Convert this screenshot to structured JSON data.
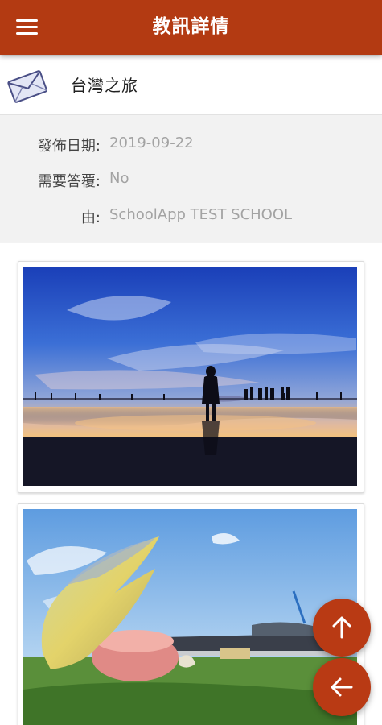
{
  "header": {
    "title": "教訊詳情",
    "menu_icon": "hamburger-menu-icon",
    "color": "#b33a12"
  },
  "message": {
    "icon": "envelope-icon",
    "subject": "台灣之旅"
  },
  "details": [
    {
      "label": "發佈日期:",
      "value": "2019-09-22"
    },
    {
      "label": "需要答覆:",
      "value": "No"
    },
    {
      "label": "由:",
      "value": "SchoolApp TEST SCHOOL"
    }
  ],
  "attachments": [
    {
      "type": "photo",
      "scene": "silhouette-sunset-beach"
    },
    {
      "type": "photo",
      "scene": "crab-claw-sculpture"
    }
  ],
  "actions": {
    "scroll_top_icon": "arrow-up-icon",
    "back_icon": "arrow-left-icon",
    "accent": "#b93a14"
  }
}
